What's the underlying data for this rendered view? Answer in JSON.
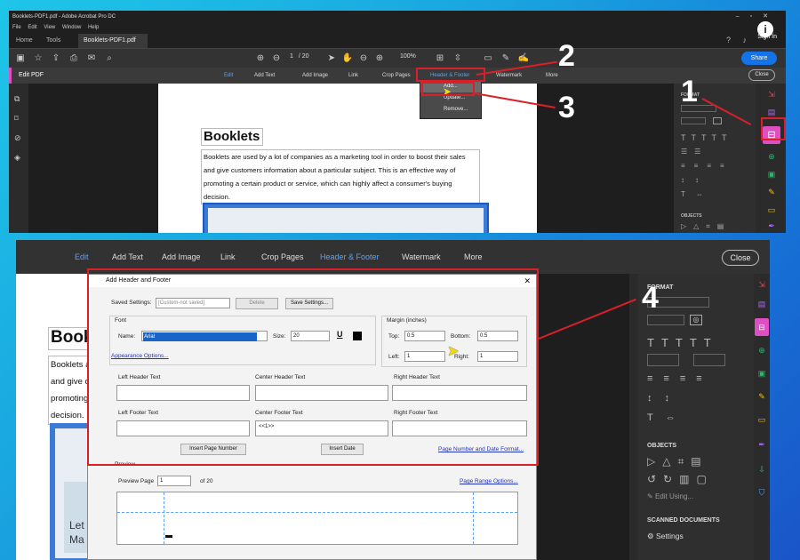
{
  "top": {
    "window_title": "Booklets-PDF1.pdf - Adobe Acrobat Pro DC",
    "menu": [
      "File",
      "Edit",
      "View",
      "Window",
      "Help"
    ],
    "tabs": [
      "Home",
      "Tools",
      "Booklets-PDF1.pdf"
    ],
    "tab_close": "×",
    "sign_in": "Sign In",
    "share": "Share",
    "page_current": "1",
    "page_total": "/ 20",
    "zoom": "100%",
    "edit_label": "Edit PDF",
    "edit_tools": [
      "Edit",
      "Add Text",
      "Add Image",
      "Link",
      "Crop Pages",
      "Header & Footer",
      "Watermark",
      "More"
    ],
    "close": "Close",
    "format_label": "FORMAT",
    "objects_label": "OBJECTS",
    "dropdown": [
      "Add...",
      "Update...",
      "Remove..."
    ],
    "doc_heading": "Booklets",
    "doc_lines": [
      "Booklets are used by a lot of companies as a marketing tool in order to boost their sales",
      "and give customers information about a particular subject. This is an effective way of",
      "promoting a certain product or service, which can highly affect a consumer's buying",
      "decision."
    ]
  },
  "bottom": {
    "edit_tools": [
      "Edit",
      "Add Text",
      "Add Image",
      "Link",
      "Crop Pages",
      "Header & Footer",
      "Watermark",
      "More"
    ],
    "close": "Close",
    "format_label": "FORMAT",
    "objects_label": "OBJECTS",
    "edit_using": "Edit Using...",
    "scanned_label": "SCANNED DOCUMENTS",
    "settings": "Settings",
    "doc_heading": "Bookle",
    "doc_lines": [
      "Booklets are",
      "and give cust",
      "promoting a c",
      "decision."
    ],
    "doc_image_text": [
      "Let",
      "Ma"
    ],
    "dialog": {
      "title": "Add Header and Footer",
      "saved_settings_label": "Saved Settings:",
      "saved_settings_value": "[Custom-not saved]",
      "delete": "Delete",
      "save_settings": "Save Settings...",
      "font_label": "Font",
      "name_label": "Name:",
      "font_name": "Arial",
      "size_label": "Size:",
      "font_size": "20",
      "underline": "U",
      "appearance": "Appearance Options...",
      "margin_label": "Margin (inches)",
      "top_label": "Top:",
      "top_value": "0.5",
      "bottom_label": "Bottom:",
      "bottom_value": "0.5",
      "left_label": "Left:",
      "left_value": "1",
      "right_label": "Right:",
      "right_value": "1",
      "left_header": "Left Header Text",
      "center_header": "Center Header Text",
      "right_header": "Right Header Text",
      "left_footer": "Left Footer Text",
      "center_footer": "Center Footer Text",
      "right_footer": "Right Footer Text",
      "center_footer_value": "<<1>>",
      "insert_page_number": "Insert Page Number",
      "insert_date": "Insert Date",
      "page_date_format": "Page Number and Date Format...",
      "preview_label": "Preview",
      "preview_page_label": "Preview Page",
      "preview_page_value": "1",
      "preview_of": "of 20",
      "page_range": "Page Range Options..."
    }
  },
  "annotations": [
    "1",
    "2",
    "3",
    "4"
  ],
  "colors": {
    "annotation_red": "#d9202a",
    "accent_pink": "#e04fc1",
    "link_blue": "#5aa2ff"
  }
}
